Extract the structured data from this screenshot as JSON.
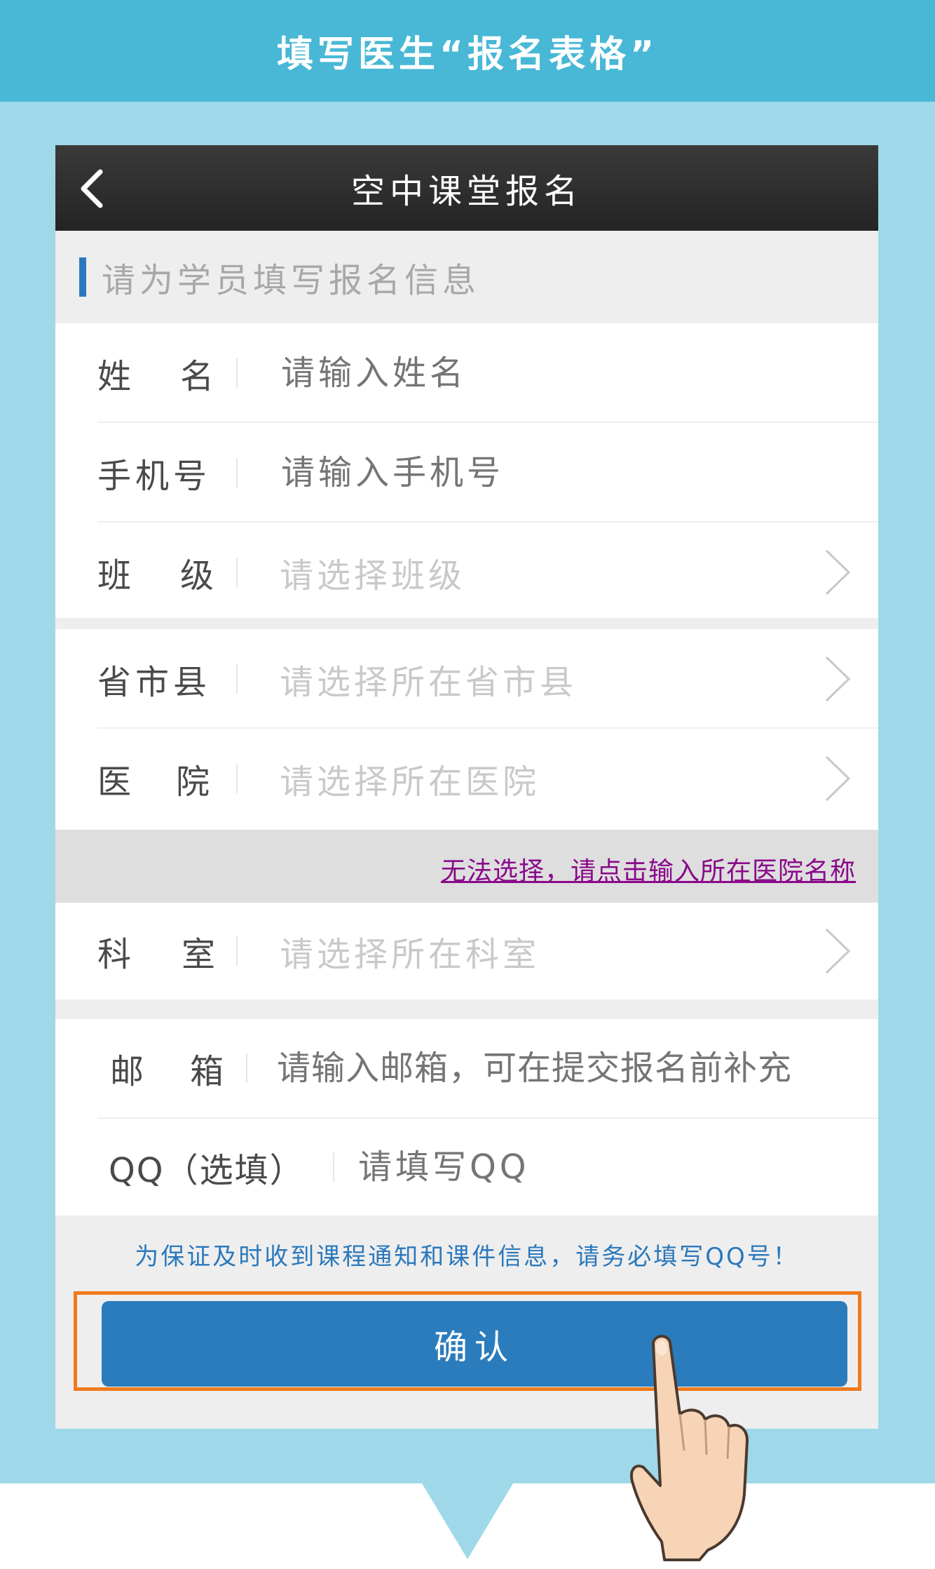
{
  "banner": {
    "title": "填写医生“报名表格”"
  },
  "nav": {
    "title": "空中课堂报名"
  },
  "section": {
    "label": "请为学员填写报名信息"
  },
  "form": {
    "name": {
      "label_a": "姓",
      "label_b": "名",
      "placeholder": "请输入姓名"
    },
    "phone": {
      "label": "手机号",
      "placeholder": "请输入手机号"
    },
    "class": {
      "label_a": "班",
      "label_b": "级",
      "placeholder": "请选择班级"
    },
    "region": {
      "label": "省市县",
      "placeholder": "请选择所在省市县"
    },
    "hospital": {
      "label_a": "医",
      "label_b": "院",
      "placeholder": "请选择所在医院"
    },
    "hospital_manual_link": "无法选择，请点击输入所在医院名称",
    "department": {
      "label_a": "科",
      "label_b": "室",
      "placeholder": "请选择所在科室"
    },
    "email": {
      "label_a": "邮",
      "label_b": "箱",
      "placeholder": "请输入邮箱，可在提交报名前补充"
    },
    "qq": {
      "label": "QQ（选填）",
      "placeholder": "请填写QQ"
    }
  },
  "notice": "为保证及时收到课程通知和课件信息，请务必填写QQ号！",
  "confirm_label": "确认",
  "icons": {
    "back": "chevron-left-icon",
    "arrow": "chevron-right-icon",
    "hand": "pointing-hand-icon"
  },
  "colors": {
    "banner": "#48b8d6",
    "background": "#9fd9e9",
    "accent": "#2b78bc",
    "highlight_frame": "#f07a1c",
    "link": "#8a0a8a"
  }
}
